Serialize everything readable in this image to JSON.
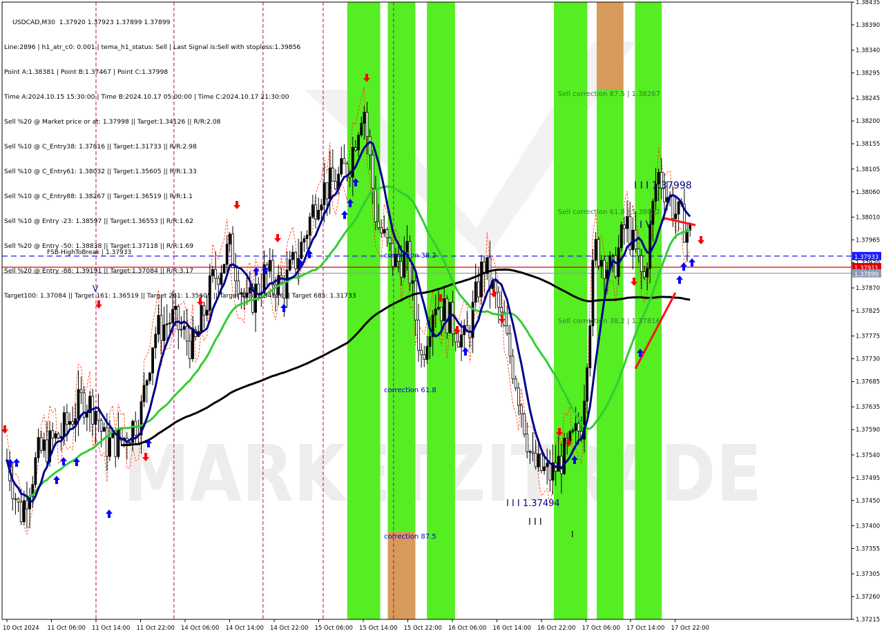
{
  "header": {
    "symbol_line": "USDCAD,M30  1.37920 1.37923 1.37899 1.37899",
    "info": [
      "Line:2896 | h1_atr_c0: 0.001 | tema_h1_status: Sell | Last Signal is:Sell with stoploss:1.39856",
      "Point A:1.38381 | Point B:1.37467 | Point C:1.37998",
      "Time A:2024.10.15 15:30:00 | Time B:2024.10.17 05:00:00 | Time C:2024.10.17 21:30:00",
      "Sell %20 @ Market price or at: 1.37998 || Target:1.34126 || R/R:2.08",
      "Sell %10 @ C_Entry38: 1.37816 || Target:1.31733 || R/R:2.98",
      "Sell %10 @ C_Entry61: 1.38032 || Target:1.35605 || R/R:1.33",
      "Sell %10 @ C_Entry88: 1.38267 || Target:1.36519 || R/R:1.1",
      "Sell %10 @ Entry -23: 1.38597 || Target:1.36553 || R/R:1.62",
      "Sell %20 @ Entry -50: 1.38838 || Target:1.37118 || R/R:1.69",
      "Sell %20 @ Entry -88: 1.39191 || Target:1.37084 || R/R:3.17",
      "Target100: 1.37084 || Target 161: 1.36519 || Target 261: 1.35605 || Target 423: 1.34126 || Target 685: 1.31733"
    ]
  },
  "chart_data": {
    "type": "candlestick",
    "symbol": "USDCAD",
    "timeframe": "M30",
    "ylim": [
      1.37215,
      1.38435
    ],
    "price_ticks": [
      "1.38435",
      "1.38390",
      "1.38340",
      "1.38295",
      "1.38245",
      "1.38200",
      "1.38155",
      "1.38105",
      "1.38060",
      "1.38010",
      "1.37965",
      "1.37920",
      "1.37870",
      "1.37825",
      "1.37775",
      "1.37730",
      "1.37685",
      "1.37635",
      "1.37590",
      "1.37540",
      "1.37495",
      "1.37450",
      "1.37400",
      "1.37355",
      "1.37305",
      "1.37260",
      "1.37215"
    ],
    "time_ticks": [
      "10 Oct 2024",
      "11 Oct 06:00",
      "11 Oct 14:00",
      "11 Oct 22:00",
      "14 Oct 06:00",
      "14 Oct 14:00",
      "14 Oct 22:00",
      "15 Oct 06:00",
      "15 Oct 14:00",
      "15 Oct 22:00",
      "16 Oct 06:00",
      "16 Oct 14:00",
      "16 Oct 22:00",
      "17 Oct 06:00",
      "17 Oct 14:00",
      "17 Oct 22:00"
    ],
    "horizontal_lines": [
      {
        "label": "FSB-HighToBreak | 1.37933",
        "price": 1.37933,
        "color": "#1a1aff",
        "style": "dashed",
        "tag": "1.37933"
      },
      {
        "label": "",
        "price": 1.37911,
        "color": "#dd0000",
        "style": "solid",
        "tag": "1.37911"
      },
      {
        "label": "",
        "price": 1.37899,
        "color": "#8a9bb5",
        "style": "solid",
        "tag": "1.37899"
      }
    ],
    "annotations": [
      {
        "text": "Sell correction 87.5 | 1.38267",
        "color": "#2f7d2f"
      },
      {
        "text": "Sell correction 61.8 | 1.38032",
        "color": "#2f7d2f"
      },
      {
        "text": "Sell correction 38.2 | 1.37816",
        "color": "#2f7d2f"
      },
      {
        "text": "I I I 1.37998",
        "color": "#00008b"
      },
      {
        "text": "I V",
        "color": "#00008b"
      },
      {
        "text": "I I I 1.37494",
        "color": "#00008b"
      },
      {
        "text": "I I I",
        "color": "#000000"
      },
      {
        "text": "I",
        "color": "#000000"
      },
      {
        "text": "V",
        "color": "#00008b"
      },
      {
        "text": "correction 38.2",
        "color": "#0000cc"
      },
      {
        "text": "correction 61.8",
        "color": "#0000cc"
      },
      {
        "text": "correction 87.5",
        "color": "#0000cc"
      }
    ],
    "zones": [
      {
        "color": "#55ee22",
        "kind": "green"
      },
      {
        "color": "#55ee22",
        "kind": "green"
      },
      {
        "color": "#55ee22",
        "kind": "green"
      },
      {
        "color": "#55ee22",
        "kind": "green"
      },
      {
        "color": "#55ee22",
        "kind": "green"
      },
      {
        "color": "#55ee22",
        "kind": "green"
      },
      {
        "color": "#d89a5a",
        "kind": "orange"
      },
      {
        "color": "#d89a5a",
        "kind": "orange"
      }
    ],
    "series": [
      {
        "color": "#00008b",
        "kind": "fast_ma"
      },
      {
        "color": "#33cc33",
        "kind": "mid_ma"
      },
      {
        "color": "#000000",
        "kind": "slow_ma"
      },
      {
        "color": "#ff3300",
        "kind": "envelope"
      }
    ],
    "watermark": "MARKETZITRADE",
    "colors": {
      "bg": "#ffffff",
      "grid_magenta": "#c0006e",
      "bull": "#000000",
      "bear": "#000000",
      "accent_blue": "#1a1aff",
      "accent_red": "#dd0000"
    }
  }
}
